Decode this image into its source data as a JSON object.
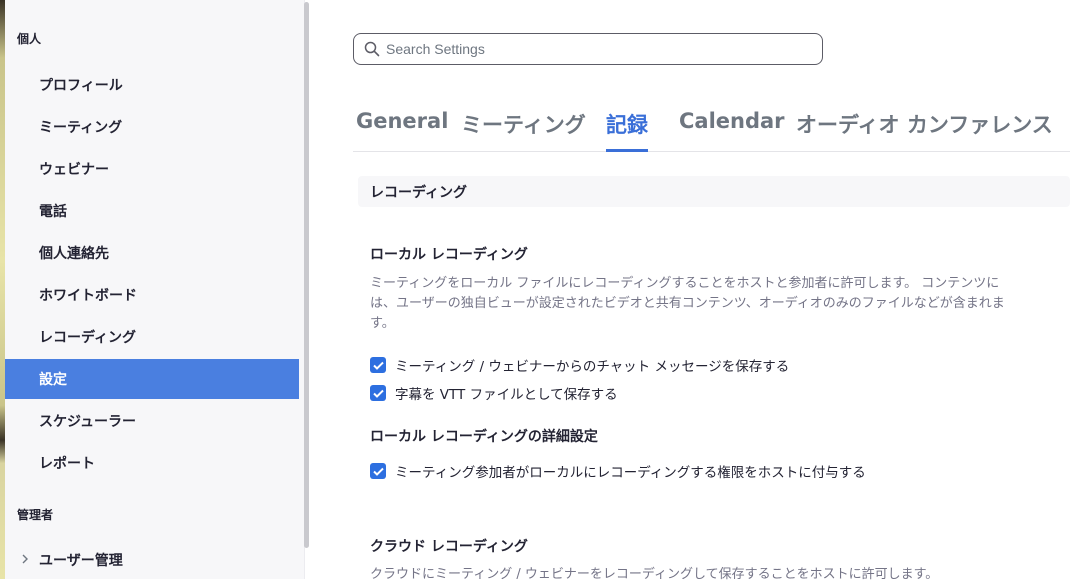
{
  "sidebar": {
    "personal_label": "個人",
    "items": [
      {
        "label": "プロフィール"
      },
      {
        "label": "ミーティング"
      },
      {
        "label": "ウェビナー"
      },
      {
        "label": "電話"
      },
      {
        "label": "個人連絡先"
      },
      {
        "label": "ホワイトボード"
      },
      {
        "label": "レコーディング"
      },
      {
        "label": "設定",
        "active": true
      },
      {
        "label": "スケジューラー"
      },
      {
        "label": "レポート"
      }
    ],
    "admin_label": "管理者",
    "admin_items": [
      {
        "label": "ユーザー管理",
        "icon": "chevron-right-icon"
      }
    ]
  },
  "search": {
    "placeholder": "Search Settings",
    "value": ""
  },
  "tabs": [
    {
      "label": "General"
    },
    {
      "label": "ミーティング"
    },
    {
      "label": "記録",
      "active": true
    },
    {
      "label": "Calendar"
    },
    {
      "label": "オーディオ カンファレンス"
    }
  ],
  "section": {
    "title": "レコーディング"
  },
  "local_recording": {
    "title": "ローカル レコーディング",
    "desc_line1": "ミーティングをローカル ファイルにレコーディングすることをホストと参加者に許可します。 コンテンツに",
    "desc_line2": "は、ユーザーの独自ビューが設定されたビデオと共有コンテンツ、オーディオのみのファイルなどが含まれま",
    "desc_line3": "す。",
    "options": [
      {
        "label": "ミーティング / ウェビナーからのチャット メッセージを保存する",
        "checked": true
      },
      {
        "label": "字幕を VTT ファイルとして保存する",
        "checked": true
      }
    ]
  },
  "local_recording_advanced": {
    "title": "ローカル レコーディングの詳細設定",
    "options": [
      {
        "label": "ミーティング参加者がローカルにレコーディングする権限をホストに付与する",
        "checked": true
      }
    ]
  },
  "cloud_recording": {
    "title": "クラウド レコーディング",
    "desc_line1": "クラウドにミーティング / ウェビナーをレコーディングして保存することをホストに許可します。"
  },
  "colors": {
    "accent": "#3a6fd8",
    "sidebar_active": "#4a7fe0",
    "checkbox": "#2d6fe0",
    "text_primary": "#232333",
    "text_secondary": "#747487"
  }
}
